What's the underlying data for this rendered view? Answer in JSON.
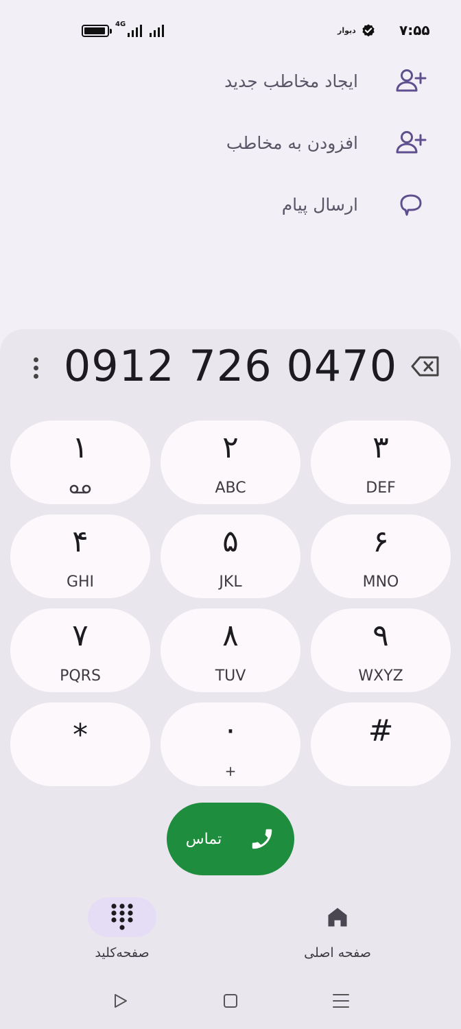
{
  "status_bar": {
    "time": "۷:۵۵",
    "app_label": "دیوار",
    "network": "4G",
    "battery_level": 0.95
  },
  "actions": [
    {
      "label": "ایجاد مخاطب جدید",
      "icon": "add-person-icon"
    },
    {
      "label": "افزودن به مخاطب",
      "icon": "add-person-icon"
    },
    {
      "label": "ارسال پیام",
      "icon": "message-icon"
    }
  ],
  "dialer": {
    "number": "0912 726 0470",
    "keys": [
      {
        "digit": "۱",
        "letters": ""
      },
      {
        "digit": "۲",
        "letters": "ABC"
      },
      {
        "digit": "۳",
        "letters": "DEF"
      },
      {
        "digit": "۴",
        "letters": "GHI"
      },
      {
        "digit": "۵",
        "letters": "JKL"
      },
      {
        "digit": "۶",
        "letters": "MNO"
      },
      {
        "digit": "۷",
        "letters": "PQRS"
      },
      {
        "digit": "۸",
        "letters": "TUV"
      },
      {
        "digit": "۹",
        "letters": "WXYZ"
      },
      {
        "digit": "*",
        "letters": ""
      },
      {
        "digit": "۰",
        "letters": "+"
      },
      {
        "digit": "#",
        "letters": ""
      }
    ],
    "call_label": "تماس"
  },
  "bottom_nav": {
    "keypad_label": "صفحه‌کلید",
    "home_label": "صفحه اصلی"
  },
  "colors": {
    "call_green": "#1e8e3e",
    "accent_purple": "#5e4f8e"
  }
}
